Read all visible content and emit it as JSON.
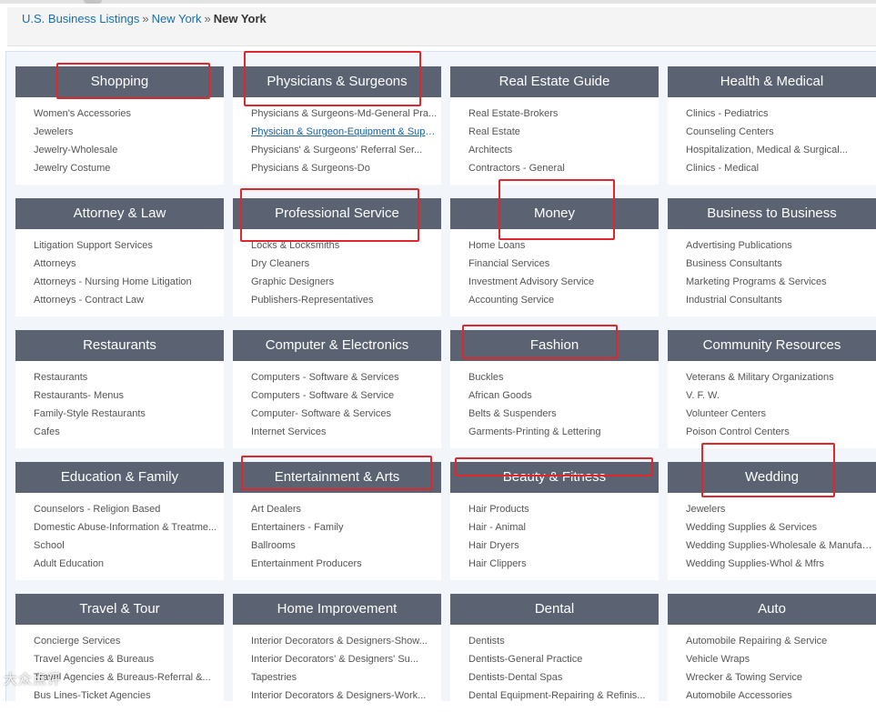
{
  "breadcrumb": {
    "root": "U.S. Business Listings",
    "state": "New York",
    "city": "New York",
    "separator": "»"
  },
  "categories": [
    {
      "title": "Shopping",
      "items": [
        "Women's Accessories",
        "Jewelers",
        "Jewelry-Wholesale",
        "Jewelry Costume"
      ]
    },
    {
      "title": "Physicians & Surgeons",
      "items": [
        "Physicians & Surgeons-Md-General Pra...",
        "Physician & Surgeon-Equipment & Supp...",
        "Physicians' & Surgeons' Referral Ser...",
        "Physicians & Surgeons-Do"
      ]
    },
    {
      "title": "Real Estate Guide",
      "items": [
        "Real Estate-Brokers",
        "Real Estate",
        "Architects",
        "Contractors - General"
      ]
    },
    {
      "title": "Health & Medical",
      "items": [
        "Clinics - Pediatrics",
        "Counseling Centers",
        "Hospitalization, Medical & Surgical...",
        "Clinics - Medical"
      ]
    },
    {
      "title": "Attorney & Law",
      "items": [
        "Litigation Support Services",
        "Attorneys",
        "Attorneys - Nursing Home Litigation",
        "Attorneys - Contract Law"
      ]
    },
    {
      "title": "Professional Service",
      "items": [
        "Locks & Locksmiths",
        "Dry Cleaners",
        "Graphic Designers",
        "Publishers-Representatives"
      ]
    },
    {
      "title": "Money",
      "items": [
        "Home Loans",
        "Financial Services",
        "Investment Advisory Service",
        "Accounting Service"
      ]
    },
    {
      "title": "Business to Business",
      "items": [
        "Advertising Publications",
        "Business Consultants",
        "Marketing Programs & Services",
        "Industrial Consultants"
      ]
    },
    {
      "title": "Restaurants",
      "items": [
        "Restaurants",
        "Restaurants- Menus",
        "Family-Style Restaurants",
        "Cafes"
      ]
    },
    {
      "title": "Computer & Electronics",
      "items": [
        "Computers - Software & Services",
        "Computers - Software & Service",
        "Computer- Software & Services",
        "Internet Services"
      ]
    },
    {
      "title": "Fashion",
      "items": [
        "Buckles",
        "African Goods",
        "Belts & Suspenders",
        "Garments-Printing & Lettering"
      ]
    },
    {
      "title": "Community Resources",
      "items": [
        "Veterans & Military Organizations",
        "V. F. W.",
        "Volunteer Centers",
        "Poison Control Centers"
      ]
    },
    {
      "title": "Education & Family",
      "items": [
        "Counselors - Religion Based",
        "Domestic Abuse-Information & Treatme...",
        "School",
        "Adult Education"
      ]
    },
    {
      "title": "Entertainment & Arts",
      "items": [
        "Art Dealers",
        "Entertainers - Family",
        "Ballrooms",
        "Entertainment Producers"
      ]
    },
    {
      "title": "Beauty & Fitness",
      "items": [
        "Hair Products",
        "Hair - Animal",
        "Hair Dryers",
        "Hair Clippers"
      ]
    },
    {
      "title": "Wedding",
      "items": [
        "Jewelers",
        "Wedding Supplies & Services",
        "Wedding Supplies-Wholesale & Manufac...",
        "Wedding Supplies-Whol & Mfrs"
      ]
    },
    {
      "title": "Travel & Tour",
      "items": [
        "Concierge Services",
        "Travel Agencies & Bureaus",
        "Travel Agencies & Bureaus-Referral &...",
        "Bus Lines-Ticket Agencies"
      ]
    },
    {
      "title": "Home Improvement",
      "items": [
        "Interior Decorators & Designers-Show...",
        "Interior Decorators' & Designers' Su...",
        "Tapestries",
        "Interior Decorators & Designers-Work..."
      ]
    },
    {
      "title": "Dental",
      "items": [
        "Dentists",
        "Dentists-General Practice",
        "Dentists-Dental Spas",
        "Dental Equipment-Repairing & Refinis..."
      ]
    },
    {
      "title": "Auto",
      "items": [
        "Automobile Repairing & Service",
        "Vehicle Wraps",
        "Wrecker & Towing Service",
        "Automobile Accessories"
      ]
    }
  ],
  "highlight_color": "#e0282c",
  "header_color": "#5b6372",
  "link_color": "#1a6fa8",
  "watermark": "大众点评"
}
